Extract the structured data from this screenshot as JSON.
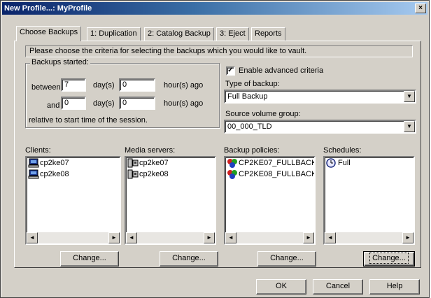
{
  "window": {
    "title": "New Profile...: MyProfile",
    "close_glyph": "×"
  },
  "tabs": [
    {
      "label": "Choose Backups",
      "active": true
    },
    {
      "label": "1: Duplication"
    },
    {
      "label": "2: Catalog Backup"
    },
    {
      "label": "3: Eject"
    },
    {
      "label": "Reports"
    }
  ],
  "instruction": "Please choose the criteria for selecting the backups which you would like to vault.",
  "backups_started": {
    "group_label": "Backups started:",
    "between_label": "between",
    "and_label": "and",
    "between_days": "7",
    "between_hours": "0",
    "and_days": "0",
    "and_hours": "0",
    "days_label": "day(s)",
    "hours_label": "hour(s) ago",
    "relative_note": "relative to start time of the session."
  },
  "advanced": {
    "checkbox_label": "Enable advanced criteria",
    "checked": true,
    "check_glyph": "✓",
    "type_label": "Type of backup:",
    "type_value": "Full Backup",
    "volume_label": "Source volume group:",
    "volume_value": "00_000_TLD"
  },
  "lists": {
    "clients": {
      "label": "Clients:",
      "items": [
        "cp2ke07",
        "cp2ke08"
      ],
      "icon": "computer-icon"
    },
    "media_servers": {
      "label": "Media servers:",
      "items": [
        "cp2ke07",
        "cp2ke08"
      ],
      "icon": "server-icon"
    },
    "policies": {
      "label": "Backup policies:",
      "items": [
        "CP2KE07_FULLBACK",
        "CP2KE08_FULLBACK"
      ],
      "icon": "policy-icon"
    },
    "schedules": {
      "label": "Schedules:",
      "items": [
        "Full"
      ],
      "icon": "clock-icon"
    }
  },
  "change_label": "Change...",
  "scroll_left_glyph": "◄",
  "scroll_right_glyph": "►",
  "dropdown_glyph": "▼",
  "buttons": {
    "ok": "OK",
    "cancel": "Cancel",
    "help": "Help"
  },
  "colors": {
    "titlebar_start": "#0a246a",
    "titlebar_end": "#a6caf0",
    "face": "#d4d0c8"
  }
}
